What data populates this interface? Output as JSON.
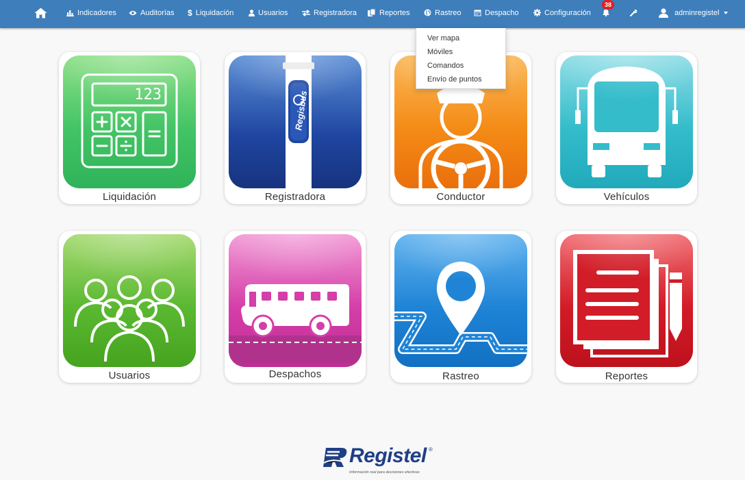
{
  "app": {
    "title": "Registel"
  },
  "colors": {
    "navbar": "#3d7ebb",
    "badge": "#e0201f",
    "liquidacion": "#43c465",
    "registradora": "#1f46a1",
    "conductor": "#f48b16",
    "vehiculos": "#34bccb",
    "usuarios": "#5ab831",
    "despachos": "#d43fa8",
    "rastreo": "#1f84d6",
    "reportes": "#d21c27"
  },
  "navbar": {
    "home_icon": "home-icon",
    "items": [
      {
        "label": "Indicadores",
        "icon": "bar-chart-icon"
      },
      {
        "label": "Auditorías",
        "icon": "eye-icon"
      },
      {
        "label": "Liquidación",
        "icon": "dollar-icon"
      },
      {
        "label": "Usuarios",
        "icon": "user-icon"
      },
      {
        "label": "Registradora",
        "icon": "exchange-icon"
      },
      {
        "label": "Reportes",
        "icon": "files-icon"
      },
      {
        "label": "Rastreo",
        "icon": "globe-icon"
      },
      {
        "label": "Despacho",
        "icon": "calendar-icon"
      },
      {
        "label": "Configuración",
        "icon": "gear-icon"
      }
    ],
    "notifications_count": "38",
    "tools_icon": "wrench-icon",
    "user_label": "adminregistel"
  },
  "rastreo_menu": {
    "items": [
      {
        "label": "Ver mapa"
      },
      {
        "label": "Móviles"
      },
      {
        "label": "Comandos"
      },
      {
        "label": "Envío de puntos"
      }
    ]
  },
  "tiles": [
    {
      "label": "Liquidación",
      "icon": "calculator-icon",
      "display": "123"
    },
    {
      "label": "Registradora",
      "icon": "registrator-icon",
      "brand": "Regisbus"
    },
    {
      "label": "Conductor",
      "icon": "driver-icon"
    },
    {
      "label": "Vehículos",
      "icon": "bus-front-icon"
    },
    {
      "label": "Usuarios",
      "icon": "users-group-icon"
    },
    {
      "label": "Despachos",
      "icon": "bus-side-icon"
    },
    {
      "label": "Rastreo",
      "icon": "map-pin-route-icon"
    },
    {
      "label": "Reportes",
      "icon": "documents-icon"
    }
  ],
  "footer": {
    "logo_text": "Registel",
    "logo_reg": "®",
    "tagline": "Información real para decisiones efectivas"
  }
}
